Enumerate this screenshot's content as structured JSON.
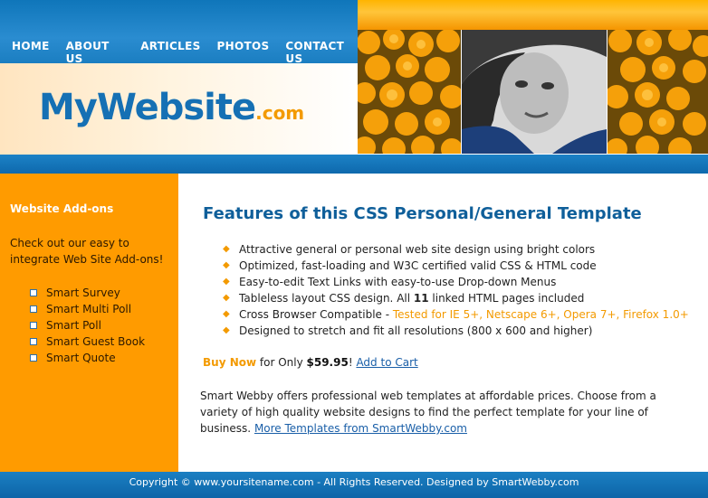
{
  "nav": {
    "items": [
      "HOME",
      "ABOUT US",
      "ARTICLES",
      "PHOTOS",
      "CONTACT US"
    ]
  },
  "logo": {
    "main": "MyWebsite",
    "suffix": ".com"
  },
  "sidebar": {
    "heading": "Website Add-ons",
    "intro": "Check out our easy to integrate Web Site Add-ons!",
    "items": [
      "Smart Survey",
      "Smart Multi Poll",
      "Smart Poll",
      "Smart Guest Book",
      "Smart Quote"
    ]
  },
  "main": {
    "title": "Features of this CSS Personal/General Template",
    "features": [
      "Attractive general or personal web site design using bright colors",
      "Optimized, fast-loading and W3C certified valid CSS & HTML code",
      "Easy-to-edit Text Links with easy-to-use Drop-down Menus"
    ],
    "feature4": {
      "before": "Tableless layout CSS design. All ",
      "bold": "11",
      "after": " linked HTML pages included"
    },
    "feature5": {
      "before": "Cross Browser Compatible - ",
      "tested": "Tested for IE 5+, Netscape 6+, Opera 7+, Firefox 1.0+"
    },
    "feature6": "Designed to stretch and fit all resolutions (800 x 600 and higher)",
    "buy": {
      "label": "Buy Now",
      "for_text": " for Only ",
      "price": "$59.95",
      "excl": "! ",
      "cart_link": "Add to Cart"
    },
    "about": {
      "text": "Smart Webby offers professional web templates at affordable prices. Choose from a variety of high quality website designs to find the perfect template for your line of business. ",
      "link": "More Templates from SmartWebby.com"
    }
  },
  "footer": {
    "text": "Copyright © www.yoursitename.com - All Rights Reserved. Designed by SmartWebby.com"
  },
  "colors": {
    "primary_blue": "#1570b4",
    "accent_orange": "#ff9b00",
    "link_blue": "#1a5fa8"
  },
  "icons": {
    "feature_bullet": "diamond-bullet-icon",
    "sidebar_bullet": "square-bullet-icon"
  }
}
